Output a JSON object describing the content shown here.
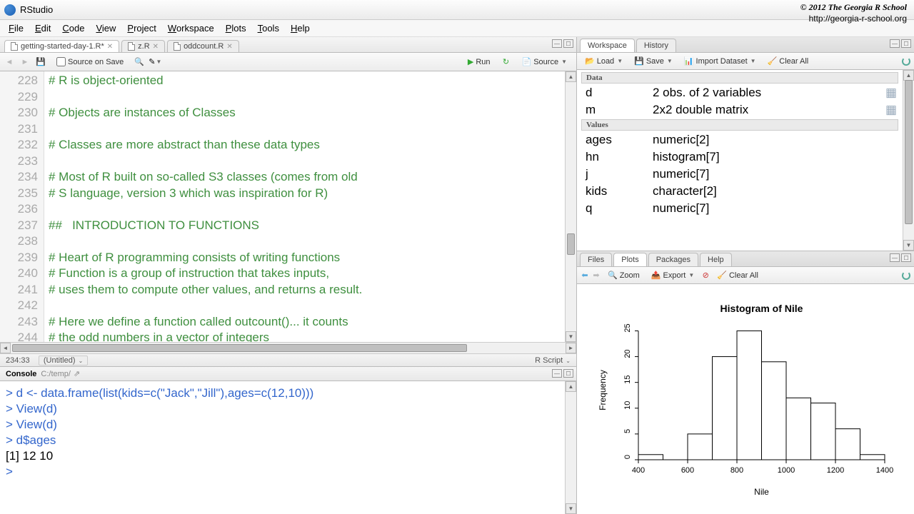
{
  "app": {
    "title": "RStudio"
  },
  "copyright": {
    "line1": "© 2012  The Georgia R School",
    "line2": "http://georgia-r-school.org"
  },
  "menus": [
    "File",
    "Edit",
    "Code",
    "View",
    "Project",
    "Workspace",
    "Plots",
    "Tools",
    "Help"
  ],
  "editor": {
    "tabs": [
      {
        "label": "getting-started-day-1.R*",
        "active": true
      },
      {
        "label": "z.R",
        "active": false
      },
      {
        "label": "oddcount.R",
        "active": false
      }
    ],
    "source_on_save": "Source on Save",
    "run": "Run",
    "source": "Source",
    "start_line": 228,
    "lines": [
      "# R is object-oriented",
      "",
      "# Objects are instances of Classes",
      "",
      "# Classes are more abstract than these data types",
      "",
      "# Most of R built on so-called S3 classes (comes from old",
      "# S language, version 3 which was inspiration for R)",
      "",
      "##   INTRODUCTION TO FUNCTIONS",
      "",
      "# Heart of R programming consists of writing functions",
      "# Function is a group of instruction that takes inputs,",
      "# uses them to compute other values, and returns a result.",
      "",
      "# Here we define a function called outcount()... it counts",
      "# the odd numbers in a vector of integers"
    ],
    "status_left": "234:33",
    "status_mid": "(Untitled)",
    "status_right": "R Script"
  },
  "console": {
    "title": "Console",
    "path": "C:/temp/",
    "lines": [
      {
        "t": "prompt",
        "text": "> d <- data.frame(list(kids=c(\"Jack\",\"Jill\"),ages=c(12,10)))"
      },
      {
        "t": "prompt",
        "text": "> View(d)"
      },
      {
        "t": "prompt",
        "text": "> View(d)"
      },
      {
        "t": "prompt",
        "text": "> d$ages"
      },
      {
        "t": "out",
        "text": "[1] 12 10"
      },
      {
        "t": "prompt",
        "text": "> "
      }
    ]
  },
  "workspace_pane": {
    "tabs": [
      "Workspace",
      "History"
    ],
    "buttons": {
      "load": "Load",
      "save": "Save",
      "import": "Import Dataset",
      "clear": "Clear All"
    },
    "sections": [
      {
        "header": "Data",
        "rows": [
          {
            "name": "d",
            "value": "2 obs. of 2 variables",
            "grid": true
          },
          {
            "name": "m",
            "value": "2x2 double matrix",
            "grid": true
          }
        ]
      },
      {
        "header": "Values",
        "rows": [
          {
            "name": "ages",
            "value": "numeric[2]"
          },
          {
            "name": "hn",
            "value": "histogram[7]"
          },
          {
            "name": "j",
            "value": "numeric[7]"
          },
          {
            "name": "kids",
            "value": "character[2]"
          },
          {
            "name": "q",
            "value": "numeric[7]"
          }
        ]
      }
    ]
  },
  "plots_pane": {
    "tabs": [
      "Files",
      "Plots",
      "Packages",
      "Help"
    ],
    "buttons": {
      "zoom": "Zoom",
      "export": "Export",
      "clear": "Clear All"
    }
  },
  "chart_data": {
    "type": "histogram",
    "title": "Histogram of Nile",
    "xlabel": "Nile",
    "ylabel": "Frequency",
    "breaks": [
      400,
      500,
      600,
      700,
      800,
      900,
      1000,
      1100,
      1200,
      1300,
      1400
    ],
    "counts": [
      1,
      0,
      5,
      20,
      25,
      19,
      12,
      11,
      6,
      1
    ],
    "x_ticks": [
      400,
      600,
      800,
      1000,
      1200,
      1400
    ],
    "y_ticks": [
      0,
      5,
      10,
      15,
      20,
      25
    ],
    "xlim": [
      400,
      1400
    ],
    "ylim": [
      0,
      27
    ]
  }
}
